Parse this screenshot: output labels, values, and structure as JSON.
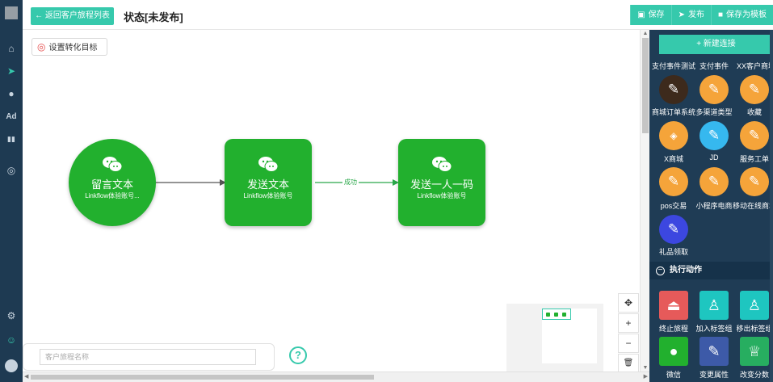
{
  "topbar": {
    "back_label": "← 返回客户旅程列表",
    "title": "状态[未发布]",
    "actions": [
      {
        "icon": "save-icon",
        "glyph": "▣",
        "label": "保存"
      },
      {
        "icon": "send-icon",
        "glyph": "➤",
        "label": "发布"
      },
      {
        "icon": "template-icon",
        "glyph": "■",
        "label": "保存为模板"
      }
    ]
  },
  "rail": {
    "items": [
      {
        "name": "home-icon",
        "glyph": "⌂"
      },
      {
        "name": "send-icon",
        "glyph": "➤",
        "active": true
      },
      {
        "name": "user-icon",
        "glyph": "●"
      },
      {
        "name": "ad-icon",
        "glyph": "Ad"
      },
      {
        "name": "chart-icon",
        "glyph": "▮▮"
      },
      {
        "name": "chat-icon",
        "glyph": "◎"
      },
      {
        "name": "settings-icon",
        "glyph": "⚙"
      },
      {
        "name": "message-icon",
        "glyph": "☺"
      }
    ]
  },
  "canvas": {
    "goal_label": "设置转化目标",
    "nodes": [
      {
        "title": "留言文本",
        "subtitle": "Linkflow体验账号..."
      },
      {
        "title": "发送文本",
        "subtitle": "Linkflow体验账号"
      },
      {
        "title": "发送一人一码",
        "subtitle": "Linkflow体验账号"
      }
    ],
    "edge_label": "成功",
    "journey_name_placeholder": "客户旅程名称",
    "zoom": [
      "✥",
      "+",
      "−",
      "🗑"
    ]
  },
  "panel": {
    "new_connection": "+ 新建连接",
    "top_labels": [
      "支付事件测试",
      "支付事件",
      "XX客户商城"
    ],
    "rows": [
      [
        {
          "label": "商城订单系统",
          "color": "dark",
          "icon": "wrench-icon"
        },
        {
          "label": "多渠道类型",
          "color": "orange",
          "icon": "wrench-icon"
        },
        {
          "label": "收藏",
          "color": "orange",
          "icon": "wrench-icon"
        }
      ],
      [
        {
          "label": "X商城",
          "color": "orange",
          "icon": "tag-icon"
        },
        {
          "label": "JD",
          "color": "blue",
          "icon": "wrench-icon"
        },
        {
          "label": "服务工单",
          "color": "orange",
          "icon": "wrench-icon"
        }
      ],
      [
        {
          "label": "pos交易",
          "color": "orange",
          "icon": "wrench-icon"
        },
        {
          "label": "小程序电商",
          "color": "orange",
          "icon": "wrench-icon"
        },
        {
          "label": "移动在线商城",
          "color": "orange",
          "icon": "wrench-icon"
        }
      ],
      [
        {
          "label": "礼品领取",
          "color": "indigo",
          "icon": "wrench-icon"
        }
      ]
    ],
    "section_title": "执行动作",
    "actions": [
      [
        {
          "label": "终止旅程",
          "color": "red",
          "icon": "stop-icon",
          "glyph": "⏏"
        },
        {
          "label": "加入标签组",
          "color": "teal",
          "icon": "add-user-icon",
          "glyph": "♙"
        },
        {
          "label": "移出标签组",
          "color": "teal",
          "icon": "remove-user-icon",
          "glyph": "♙"
        }
      ],
      [
        {
          "label": "微信",
          "color": "green",
          "icon": "wechat-icon",
          "glyph": "●"
        },
        {
          "label": "变更属性",
          "color": "navy",
          "icon": "edit-icon",
          "glyph": "✎"
        },
        {
          "label": "改变分数",
          "color": "emerald",
          "icon": "trophy-icon",
          "glyph": "♕"
        }
      ]
    ]
  }
}
